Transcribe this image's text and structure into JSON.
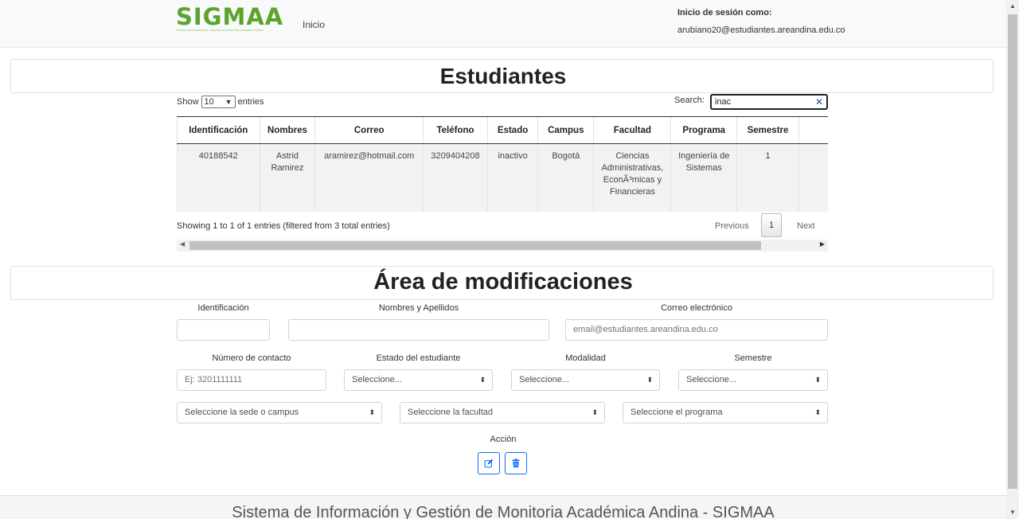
{
  "nav": {
    "logo_text": "SIGMAA",
    "logo_subtitle": "SISTEMA DE INFORMACIÓN Y GESTIÓN DE MONITORIA ACADÉMICA ANDINA",
    "home_link": "Inicio",
    "login_label": "Inicio de sesión como:",
    "login_email": "arubiano20@estudiantes.areandina.edu.co"
  },
  "students": {
    "title": "Estudiantes",
    "show_label": "Show",
    "entries_value": "10",
    "entries_label": "entries",
    "search_label": "Search:",
    "search_value": "inac",
    "columns": [
      "Identificación",
      "Nombres",
      "Correo",
      "Teléfono",
      "Estado",
      "Campus",
      "Facultad",
      "Programa",
      "Semestre",
      ""
    ],
    "rows": [
      [
        "40188542",
        "Astrid Ramirez",
        "aramirez@hotmail.com",
        "3209404208",
        "inactivo",
        "Bogotá",
        "Ciencias Administrativas, EconÃ³micas y Financieras",
        "Ingeniería de Sistemas",
        "1",
        ""
      ]
    ],
    "info": "Showing 1 to 1 of 1 entries (filtered from 3 total entries)",
    "previous": "Previous",
    "page": "1",
    "next": "Next"
  },
  "modifications": {
    "title": "Área de modificaciones",
    "id_label": "Identificación",
    "name_label": "Nombres y Apellidos",
    "email_label": "Correo electrónico",
    "email_placeholder": "email@estudiantes.areandina.edu.co",
    "contact_label": "Número de contacto",
    "contact_placeholder": "Ej: 3201111111",
    "status_label": "Estado del estudiante",
    "status_value": "Seleccione...",
    "modality_label": "Modalidad",
    "modality_value": "Seleccione...",
    "semester_label": "Semestre",
    "semester_value": "Seleccione...",
    "campus_value": "Seleccione la sede o campus",
    "faculty_value": "Seleccione la facultad",
    "program_value": "Seleccione el programa",
    "action_label": "Acción",
    "edit_icon": "edit-icon",
    "delete_icon": "trash-icon"
  },
  "footer": {
    "text": "Sistema de Información y Gestión de Monitoria Académica Andina - SIGMAA"
  },
  "colors": {
    "brand_green": "#5aa42a",
    "action_blue": "#0d6efd"
  }
}
